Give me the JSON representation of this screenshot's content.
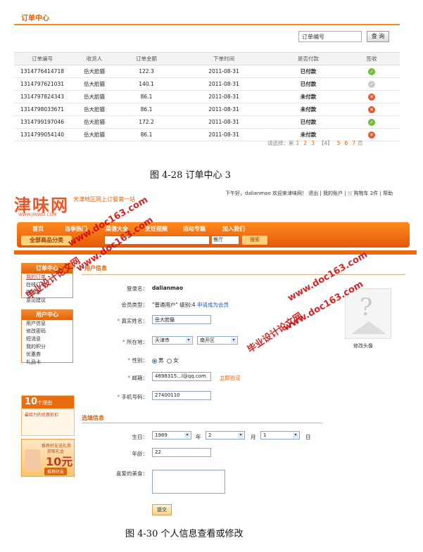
{
  "order_center": {
    "title": "订单中心",
    "search_placeholder": "订单编号",
    "search_button": "查 询",
    "columns": [
      "订单编号",
      "收货人",
      "订单金额",
      "下单时间",
      "是否付款",
      "签收"
    ],
    "rows": [
      {
        "id": "1314776414718",
        "receiver": "岳大脸猫",
        "amount": "122.3",
        "time": "2011-08-31",
        "paid": "已付款",
        "sign": "green"
      },
      {
        "id": "1314797621031",
        "receiver": "岳大脸猫",
        "amount": "140.1",
        "time": "2011-08-31",
        "paid": "已付款",
        "sign": "gray"
      },
      {
        "id": "1314797824343",
        "receiver": "岳大脸猫",
        "amount": "86.1",
        "time": "2011-08-31",
        "paid": "未付款",
        "sign": "red"
      },
      {
        "id": "1314798033671",
        "receiver": "岳大脸猫",
        "amount": "86.1",
        "time": "2011-08-31",
        "paid": "未付款",
        "sign": "red"
      },
      {
        "id": "1314799197046",
        "receiver": "岳大脸猫",
        "amount": "172.2",
        "time": "2011-08-31",
        "paid": "已付款",
        "sign": "green"
      },
      {
        "id": "1314799054140",
        "receiver": "岳大脸猫",
        "amount": "86.1",
        "time": "2011-08-31",
        "paid": "未付款",
        "sign": "red"
      }
    ],
    "pager": {
      "prefix": "请选择：第",
      "p1": "1",
      "p2": "2",
      "p3": "3",
      "current": "【4】",
      "p5": "5",
      "p6": "6",
      "p7": "7",
      "suffix": "页"
    }
  },
  "caption_top": "图 4-28  订单中心 3",
  "caption_bottom": "图 4-30  个人信息查看或修改",
  "site": {
    "logo": "津味网",
    "logo_sub": "WWW.JINWEI.COM",
    "slogan": "天津地区网上订餐第一站",
    "greeting": "下午好，dalianmao 欢迎来津味网！",
    "logout": "退出",
    "my_account": "我的账户",
    "cart": "购物车 2件",
    "help": "帮助",
    "nav": [
      "首页",
      "当季热门",
      "菜谱大全",
      "烹饪视频",
      "活动专题",
      "加入我们"
    ],
    "category_btn": "全部商品分类",
    "nav_select": "餐厅",
    "nav_search": "搜索"
  },
  "sidebar": {
    "order_title": "订单中心",
    "order_items": [
      "我的订单",
      "在线订单",
      "购物车",
      "意见建议"
    ],
    "user_title": "用户中心",
    "user_items": [
      "用户信息",
      "修改密码",
      "短消息",
      "我的积分",
      "优惠券",
      "礼品卡"
    ]
  },
  "ads": {
    "reason_num": "10",
    "reason_text": "个理由",
    "reason_sub": "最给力的优惠折扣",
    "gift_top": "推荐好友送礼券",
    "gift_mid": "获取礼金",
    "gift_amount": "10元",
    "gift_btn": "推荐好友"
  },
  "profile": {
    "section_basic": "用户信息",
    "username_label": "登录名：",
    "username": "dalianmao",
    "member_label": "会员类型：",
    "member_type": "\"普通用户\" 级别:4",
    "member_link": "申请成为会员",
    "realname_label": "真实姓名：",
    "realname": "岳大脸猫",
    "location_label": "所在地：",
    "city": "天津市",
    "district": "南开区",
    "gender_label": "性别：",
    "male": "男",
    "female": "女",
    "email_label": "邮箱：",
    "email": "4698315...l@qq.com",
    "verify_link": "立即验证",
    "phone_label": "手机号码：",
    "phone": "27400110",
    "avatar_label": "修改头像",
    "section_optional": "选填信息",
    "birthday_label": "生日：",
    "year": "1989",
    "year_unit": "年",
    "month": "2",
    "month_unit": "月",
    "day": "1",
    "day_unit": "日",
    "age_label": "年龄：",
    "age": "22",
    "food_label": "喜爱的美食：",
    "submit": "提交"
  },
  "watermarks": {
    "site_url": "www.doc163.com",
    "cn": "毕业设计论文网"
  }
}
